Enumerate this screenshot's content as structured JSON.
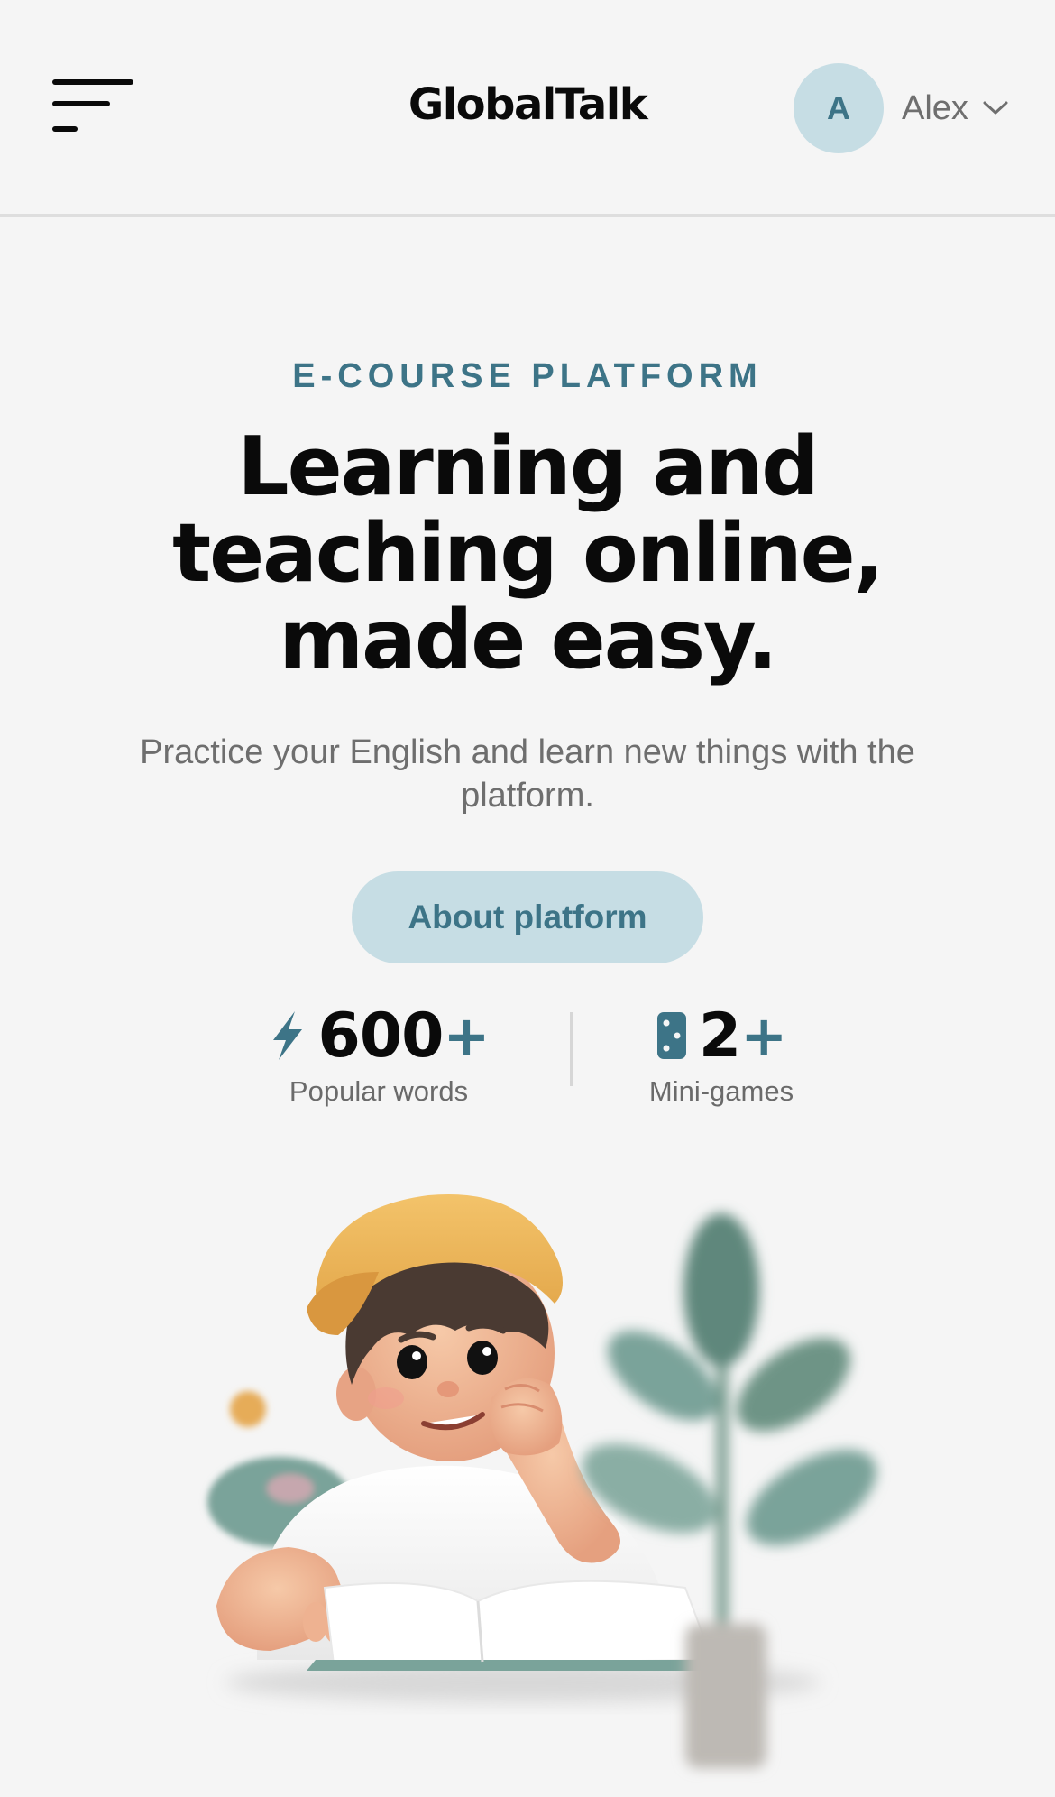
{
  "header": {
    "logo": "GlobalTalk",
    "user": {
      "initial": "A",
      "name": "Alex"
    },
    "icons": {
      "menu": "hamburger-menu-icon",
      "dropdown": "chevron-down-icon"
    }
  },
  "hero": {
    "eyebrow": "E-COURSE PLATFORM",
    "headline_line1": "Learning and",
    "headline_line2": "teaching online,",
    "headline_line3": "made easy.",
    "subtext": "Practice your English and learn new things with the platform.",
    "cta_label": "About platform"
  },
  "stats": [
    {
      "icon": "lightning-icon",
      "value": "600",
      "suffix": "+",
      "label": "Popular words"
    },
    {
      "icon": "dice-icon",
      "value": "2",
      "suffix": "+",
      "label": "Mini-games"
    }
  ],
  "colors": {
    "accent": "#3d7487",
    "accent_light": "#c6dde4",
    "background": "#f5f5f5",
    "text_primary": "#0a0a0a",
    "text_secondary": "#6e6e6e"
  }
}
